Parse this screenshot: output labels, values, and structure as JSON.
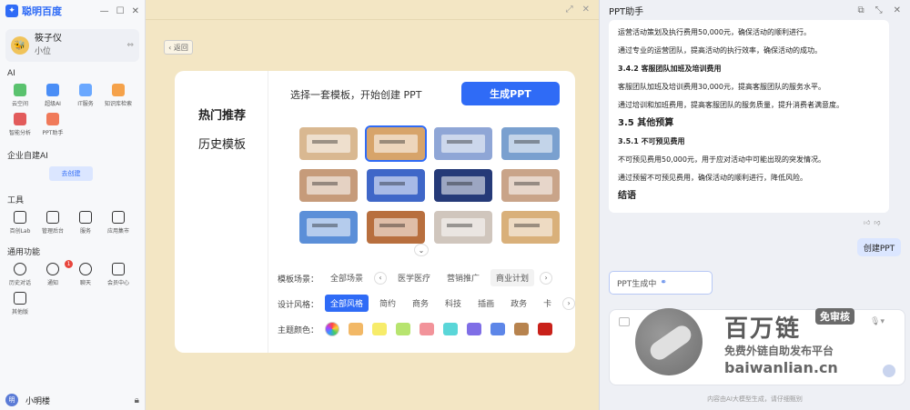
{
  "sidebar": {
    "brand": "聪明百度",
    "user": {
      "name": "筱子仪",
      "sub": "小位"
    },
    "sections": {
      "ai": "AI",
      "enterprise": "企业自建AI",
      "tools": "工具",
      "common": "通用功能"
    },
    "ai_apps": [
      {
        "label": "云空间",
        "color": "#5ac26e"
      },
      {
        "label": "超级AI",
        "color": "#4a8ef6"
      },
      {
        "label": "IT服务",
        "color": "#6aa8ff"
      },
      {
        "label": "知识库检索",
        "color": "#f5a24a"
      },
      {
        "label": "智能分析",
        "color": "#e25b5b"
      },
      {
        "label": "PPT助手",
        "color": "#f07a5a"
      }
    ],
    "create_btn": "去创建",
    "tools": [
      {
        "label": "百创Lab",
        "icon": "monitor-icon"
      },
      {
        "label": "管理后台",
        "icon": "dashboard-icon"
      },
      {
        "label": "服务",
        "icon": "headset-icon"
      },
      {
        "label": "应用集市",
        "icon": "bag-icon"
      }
    ],
    "common": [
      {
        "label": "历史对话",
        "icon": "clock-icon"
      },
      {
        "label": "通知",
        "icon": "bell-icon",
        "badge": "1"
      },
      {
        "label": "聊天",
        "icon": "chat-icon"
      },
      {
        "label": "会员中心",
        "icon": "diamond-icon"
      },
      {
        "label": "其他版",
        "icon": "windows-icon"
      }
    ],
    "bottom_user": "小明楼",
    "bottom_avatar": "明"
  },
  "middle": {
    "back_label": "返回",
    "nav": {
      "hot": "热门推荐",
      "history": "历史模板"
    },
    "prompt": "选择一套模板，开始创建 PPT",
    "generate_btn": "生成PPT",
    "thumbs": [
      "#d9b891",
      "#d7a46a",
      "#8fa6d6",
      "#7aa0cf",
      "#c69b7a",
      "#3f67c8",
      "#253a78",
      "#c9a489",
      "#5b8fd8",
      "#b86f3e",
      "#d0c6bd",
      "#d9b07a"
    ],
    "scene_label": "模板场景：",
    "scenes": [
      "全部场景",
      "医学医疗",
      "营销推广",
      "商业计划"
    ],
    "style_label": "设计风格：",
    "styles": [
      "全部风格",
      "简约",
      "商务",
      "科技",
      "插画",
      "政务",
      "卡"
    ],
    "color_label": "主题颜色：",
    "colors": [
      "#f2b866",
      "#f7ec6a",
      "#b7e46f",
      "#f2939a",
      "#5ad6d8",
      "#7f6ee6",
      "#5d86e8",
      "#b7834e",
      "#c9211a"
    ]
  },
  "right": {
    "title": "PPT助手",
    "doc": [
      {
        "t": "运营活动策划及执行费用50,000元，确保活动的顺利进行。",
        "k": "p"
      },
      {
        "t": "通过专业的运营团队，提高活动的执行效率，确保活动的成功。",
        "k": "p"
      },
      {
        "t": "3.4.2 客服团队加班及培训费用",
        "k": "h3"
      },
      {
        "t": "客服团队加班及培训费用30,000元，提高客服团队的服务水平。",
        "k": "p"
      },
      {
        "t": "通过培训和加班费用，提高客服团队的服务质量，提升消费者满意度。",
        "k": "p"
      },
      {
        "t": "3.5 其他预算",
        "k": "h"
      },
      {
        "t": "3.5.1 不可预见费用",
        "k": "h3"
      },
      {
        "t": "不可预见费用50,000元，用于应对活动中可能出现的突发情况。",
        "k": "p"
      },
      {
        "t": "通过预留不可预见费用，确保活动的顺利进行，降低风险。",
        "k": "p"
      },
      {
        "t": "结语",
        "k": "h"
      }
    ],
    "user_msg": "创建PPT",
    "status": "PPT生成中",
    "footnote": "内容由AI大模型生成，请仔细甄别"
  },
  "watermark": {
    "title": "百万链",
    "tag": "免审核",
    "sub": "免费外链自助发布平台",
    "url": "baiwanlian.cn"
  }
}
